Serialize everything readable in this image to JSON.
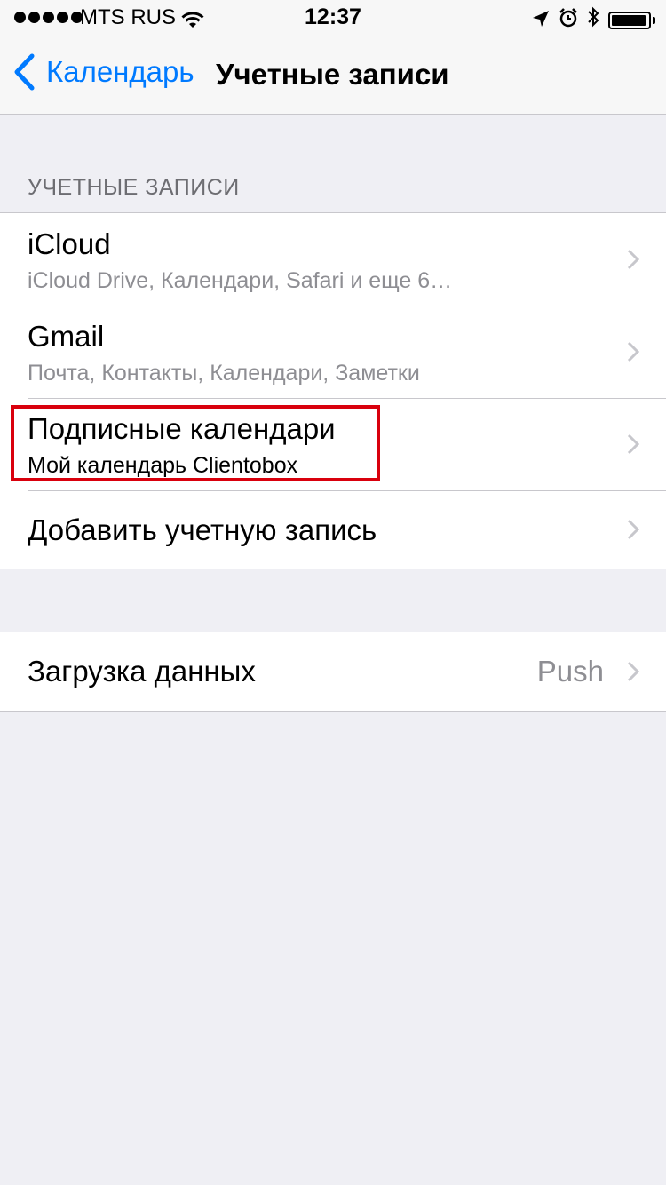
{
  "status_bar": {
    "carrier": "MTS RUS",
    "time": "12:37",
    "signal_bars": 5,
    "battery_level": 0.95,
    "icons": [
      "signal-dots-icon",
      "wifi-icon",
      "location-arrow-icon",
      "alarm-clock-icon",
      "bluetooth-icon",
      "battery-icon"
    ]
  },
  "nav": {
    "back_label": "Календарь",
    "title": "Учетные записи"
  },
  "accounts_section": {
    "header": "УЧЕТНЫЕ ЗАПИСИ",
    "rows": [
      {
        "title": "iCloud",
        "subtitle": "iCloud Drive, Календари, Safari и еще 6…"
      },
      {
        "title": "Gmail",
        "subtitle": "Почта, Контакты, Календари, Заметки"
      },
      {
        "title": "Подписные календари",
        "subtitle": "Мой календарь Clientobox"
      },
      {
        "title": "Добавить учетную запись"
      }
    ]
  },
  "fetch_section": {
    "title": "Загрузка данных",
    "value": "Push"
  },
  "colors": {
    "accent": "#007aff",
    "highlight_border": "#d9000d",
    "background": "#efeff4"
  }
}
